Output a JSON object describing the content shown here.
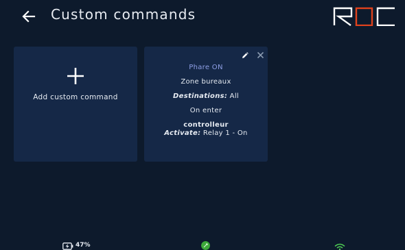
{
  "header": {
    "title": "Custom commands",
    "logo_text": "ROC",
    "accent_color": "#e0421d"
  },
  "add_card": {
    "label": "Add custom command"
  },
  "commands": [
    {
      "name": "Phare ON",
      "zone": "Zone bureaux",
      "destinations_label": "Destinations:",
      "destinations_value": "All",
      "trigger": "On enter",
      "device": "controlleur",
      "action_label": "Activate:",
      "action_value": "Relay 1 - On"
    }
  ],
  "status_bar": {
    "battery_percent": "47%",
    "battery_icon": "battery-charging-icon",
    "status_icon": "plugged-status-icon",
    "status_color": "#3ca83a",
    "wifi_icon": "wifi-icon",
    "wifi_color": "#4fcf55"
  }
}
